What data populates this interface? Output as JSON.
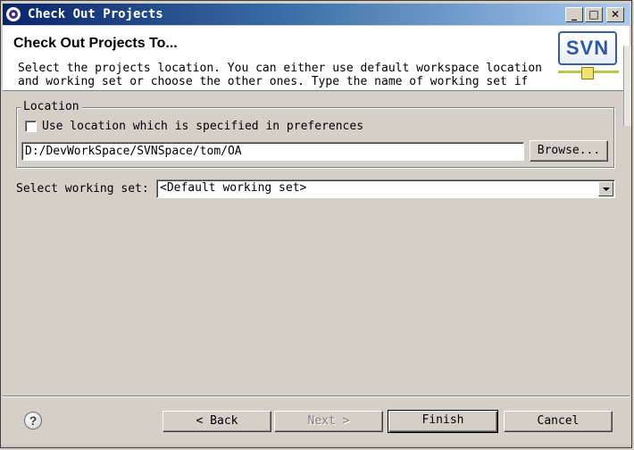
{
  "window": {
    "title": "Check Out Projects",
    "controls": {
      "minimize": "_",
      "maximize": "□",
      "close": "✕"
    }
  },
  "banner": {
    "heading": "Check Out Projects To...",
    "description_line1": "Select the projects location. You can either use default workspace location",
    "description_line2": "and working set or choose the other ones. Type the name of working set if",
    "logo_text": "SVN"
  },
  "location": {
    "legend": "Location",
    "use_preferences_label": "Use location which is specified in preferences",
    "use_preferences_checked": false,
    "path_value": "D:/DevWorkSpace/SVNSpace/tom/OA",
    "browse_label": "Browse..."
  },
  "working_set": {
    "label": "Select working set:",
    "selected": "<Default working set>"
  },
  "footer": {
    "help_label": "?",
    "back_label": "< Back",
    "next_label": "Next >",
    "finish_label": "Finish",
    "cancel_label": "Cancel"
  },
  "colors": {
    "dialog_bg": "#d4d0c8",
    "titlebar_start": "#0a246a",
    "titlebar_end": "#a6caf0",
    "svn_blue": "#2a5aa8"
  }
}
